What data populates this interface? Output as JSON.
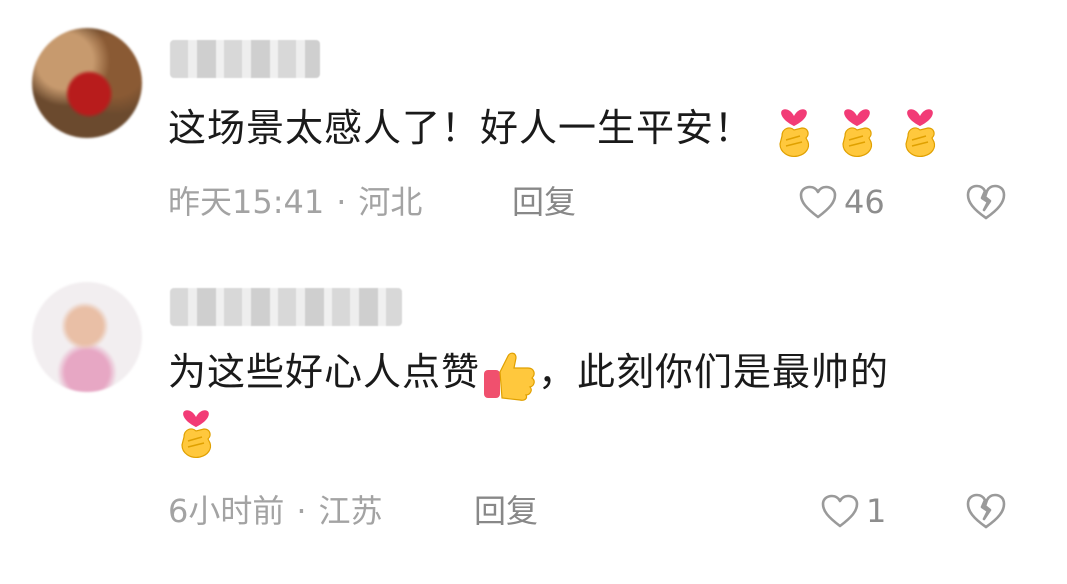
{
  "comments": [
    {
      "username": "",
      "text": "这场景太感人了！好人一生平安！",
      "emojis": [
        "heart-hands-emoji",
        "heart-hands-emoji",
        "heart-hands-emoji"
      ],
      "time": "昨天15:41",
      "separator": "·",
      "location": "河北",
      "reply_label": "回复",
      "like_count": "46",
      "icons": {
        "like": "heart-outline-icon",
        "dislike": "broken-heart-icon"
      }
    },
    {
      "username": "",
      "text": "为这些好心人点赞",
      "emoji_mid": "thumbs-up-emoji",
      "text_tail": "，此刻你们是最帅的",
      "emojis": [
        "heart-hands-emoji"
      ],
      "time": "6小时前",
      "separator": "·",
      "location": "江苏",
      "reply_label": "回复",
      "like_count": "1",
      "icons": {
        "like": "heart-outline-icon",
        "dislike": "broken-heart-icon"
      }
    }
  ],
  "colors": {
    "meta": "#a3a3a3",
    "text": "#1a1a1a",
    "icon": "#8d8d8d"
  }
}
